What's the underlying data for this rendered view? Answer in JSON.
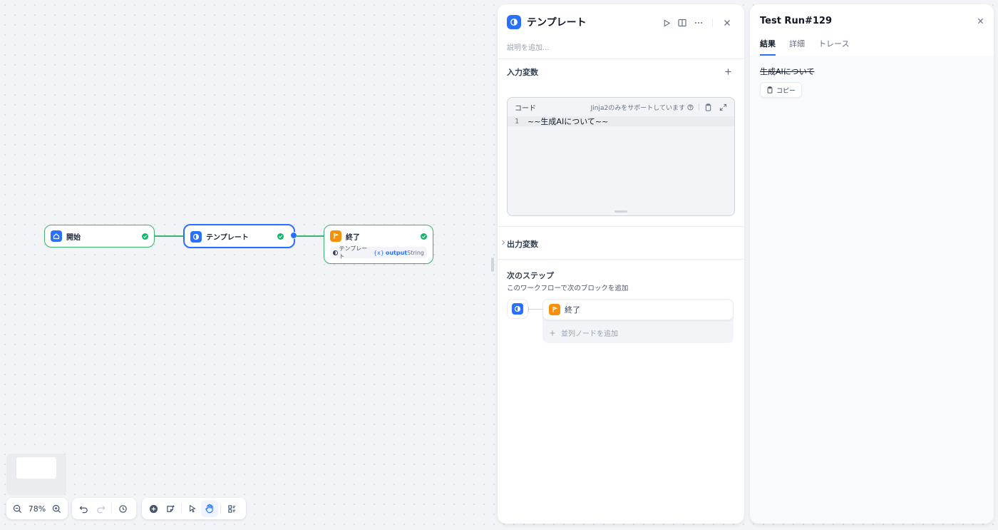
{
  "canvas": {
    "nodes": {
      "start": {
        "title": "開始"
      },
      "template": {
        "title": "テンプレート"
      },
      "end": {
        "title": "終了",
        "var_node": "テンプレート",
        "var_icon": "{x}",
        "var_name": "output",
        "var_type": "String"
      }
    },
    "zoom": "78%"
  },
  "template_panel": {
    "title": "テンプレート",
    "description_placeholder": "説明を追加...",
    "input_vars_title": "入力変数",
    "code": {
      "label": "コード",
      "support_text": "Jinja2のみをサポートしています",
      "line_number": "1",
      "line_text": "~~生成AIについて~~"
    },
    "output_vars_title": "出力変数",
    "next_step": {
      "title": "次のステップ",
      "subtitle": "このワークフローで次のブロックを追加",
      "item_label": "終了",
      "add_parallel": "並列ノードを追加"
    }
  },
  "run_panel": {
    "title": "Test Run#129",
    "tabs": [
      "結果",
      "詳細",
      "トレース"
    ],
    "result_text": "生成AIについて",
    "copy_label": "コピー"
  },
  "colors": {
    "accent": "#2970ff",
    "success": "#12b76a",
    "node_border": "#3cb371",
    "end_icon": "#f79009"
  }
}
